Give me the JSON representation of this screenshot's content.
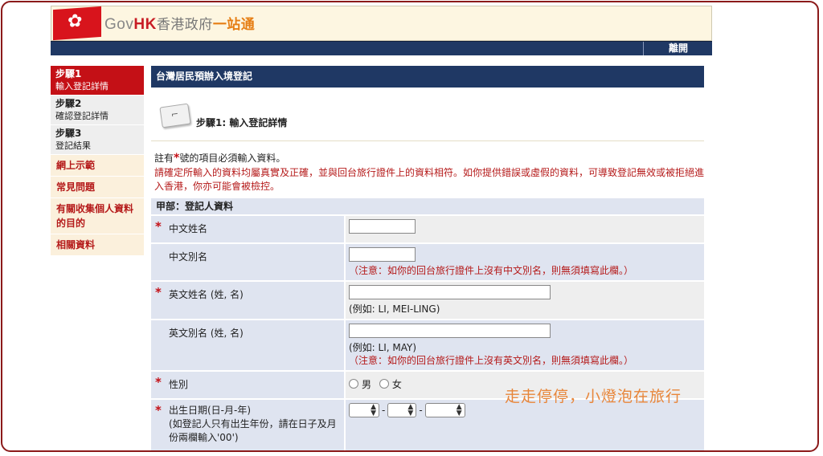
{
  "header": {
    "logo_gov": "Gov",
    "logo_hk": "HK",
    "logo_zh": "香港政府",
    "logo_zh2": "一站通",
    "logout_label": "離開"
  },
  "sidebar": {
    "steps": [
      {
        "title": "步驟1",
        "subtitle": "輸入登記詳情"
      },
      {
        "title": "步驟2",
        "subtitle": "確認登記詳情"
      },
      {
        "title": "步驟3",
        "subtitle": "登記結果"
      }
    ],
    "links": [
      "網上示範",
      "常見問題",
      "有關收集個人資料的目的",
      "相關資料"
    ]
  },
  "main": {
    "title": "台灣居民預辦入境登記",
    "step_label": "步驟1: 輸入登記詳情",
    "note_prefix": "註有",
    "note_asterisk": "*",
    "note_suffix": "號的項目必須輸入資料。",
    "warning": "請確定所輸入的資料均屬真實及正確，並與回台旅行證件上的資料相符。如你提供錯誤或虛假的資料，可導致登記無效或被拒絕進入香港，你亦可能會被檢控。",
    "section_title": "甲部：登記人資料"
  },
  "form": {
    "chinese_name": {
      "label": "中文姓名",
      "value": ""
    },
    "chinese_alias": {
      "label": "中文別名",
      "value": "",
      "note": "（注意：如你的回台旅行證件上沒有中文別名，則無須填寫此欄。）"
    },
    "english_name": {
      "label": "英文姓名 (姓, 名)",
      "value": "",
      "example": "(例如: LI, MEI-LING)"
    },
    "english_alias": {
      "label": "英文別名 (姓, 名)",
      "value": "",
      "example": "(例如: LI, MAY)",
      "note": "（注意：如你的回台旅行證件上沒有英文別名，則無須填寫此欄。）"
    },
    "gender": {
      "label": "性別",
      "options": [
        "男",
        "女"
      ]
    },
    "dob": {
      "label": "出生日期(日-月-年)",
      "sublabel": "(如登記人只有出生年份，請在日子及月份兩欄輸入'00')",
      "day": "",
      "month": "",
      "year": ""
    }
  },
  "watermark": "走走停停，小燈泡在旅行",
  "colors": {
    "navy": "#1f3864",
    "red": "#c41016",
    "frame": "#8b1a1a",
    "orange": "#e8863a"
  }
}
